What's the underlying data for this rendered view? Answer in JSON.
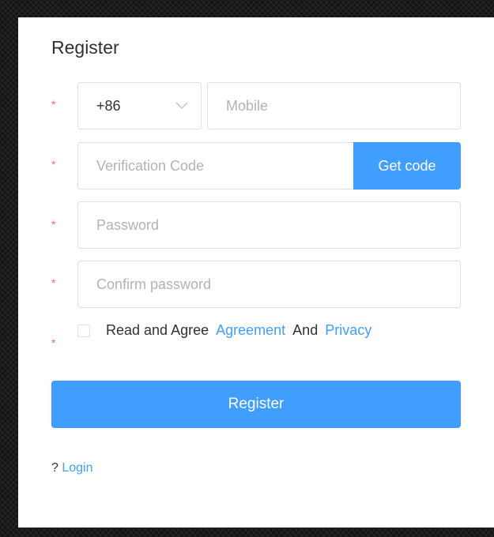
{
  "form": {
    "title": "Register",
    "required_mark": "*",
    "country_code": {
      "selected": "+86",
      "icon": "chevron-down-icon"
    },
    "mobile": {
      "placeholder": "Mobile",
      "value": ""
    },
    "verification": {
      "placeholder": "Verification Code",
      "value": ""
    },
    "get_code_label": "Get code",
    "password": {
      "placeholder": "Password",
      "value": ""
    },
    "confirm_password": {
      "placeholder": "Confirm password",
      "value": ""
    },
    "agreement": {
      "checked": false,
      "prefix": "Read and Agree",
      "agreement_link": "Agreement",
      "conjunction": "And",
      "privacy_link": "Privacy"
    },
    "register_label": "Register",
    "footer": {
      "prefix": "?",
      "login_link": "Login"
    }
  },
  "colors": {
    "accent": "#409eff",
    "required": "#f56c6c",
    "border": "#dcdfe6",
    "text": "#303133",
    "placeholder": "#b0b3b8"
  }
}
